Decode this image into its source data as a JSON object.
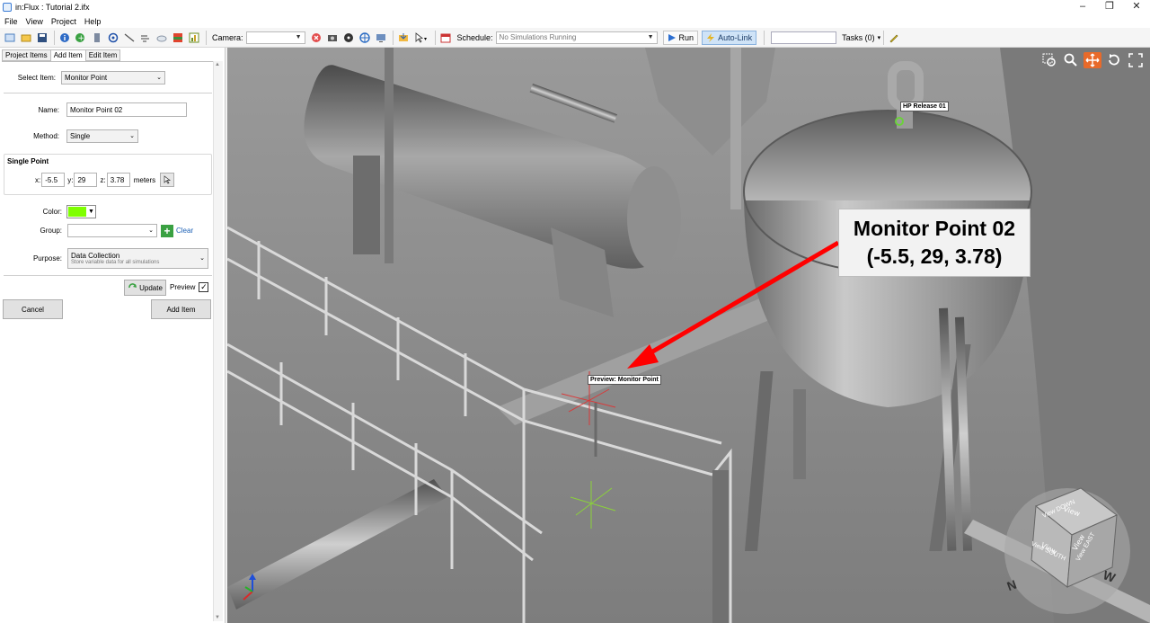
{
  "window": {
    "title": "in:Flux : Tutorial 2.ifx",
    "minimize": "–",
    "restore": "❐",
    "close": "✕"
  },
  "menu": [
    "File",
    "View",
    "Project",
    "Help"
  ],
  "toolbar": {
    "camera_label": "Camera:",
    "camera_value": "",
    "schedule_label": "Schedule:",
    "schedule_value": "No Simulations Running",
    "run_label": "Run",
    "autolink_label": "Auto-Link",
    "tasks_label": "Tasks (0)"
  },
  "tabs": [
    "Project Items",
    "Add Item",
    "Edit Item"
  ],
  "form": {
    "select_item_label": "Select Item:",
    "select_item_value": "Monitor Point",
    "name_label": "Name:",
    "name_value": "Monitor Point 02",
    "method_label": "Method:",
    "method_value": "Single",
    "single_point_label": "Single Point",
    "x_label": "x:",
    "x_value": "-5.5",
    "y_label": "y:",
    "y_value": "29",
    "z_label": "z:",
    "z_value": "3.78",
    "units": "meters",
    "color_label": "Color:",
    "color_value": "#7fff00",
    "group_label": "Group:",
    "group_value": "",
    "clear_label": "Clear",
    "purpose_label": "Purpose:",
    "purpose_value": "Data Collection",
    "purpose_desc": "Store variable data for all simulations",
    "update_label": "Update",
    "preview_label": "Preview",
    "preview_checked": true,
    "cancel_label": "Cancel",
    "add_item_label": "Add Item"
  },
  "viewport": {
    "callout_line1": "Monitor Point 02",
    "callout_line2": "(-5.5, 29, 3.78)",
    "hp_release_tag": "HP Release 01",
    "preview_tag": "Preview: Monitor Point",
    "cube_labels": {
      "top": "View DOWN",
      "front": "View SOUTH",
      "right": "View EAST"
    },
    "compass": {
      "n": "N",
      "w": "W"
    }
  }
}
